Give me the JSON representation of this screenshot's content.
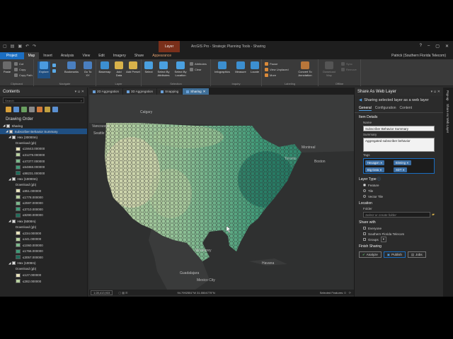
{
  "app": {
    "title": "ArcGIS Pro - Strategic Planning Tools - Sharing",
    "context_tab": "Layer",
    "user": "Patrick (Southern Florida Telecom)"
  },
  "ribbon_tabs": [
    "Project",
    "Map",
    "Insert",
    "Analysis",
    "View",
    "Edit",
    "Imagery",
    "Share",
    "Appearance"
  ],
  "ribbon": {
    "groups": [
      "Clipboard",
      "Navigate",
      "Layer",
      "Selection",
      "Inquiry",
      "Labeling",
      "Offline"
    ],
    "buttons": {
      "paste": "Paste",
      "cut": "Cut",
      "copy": "Copy",
      "copy_path": "Copy Path",
      "explore": "Explore",
      "bookmarks": "Bookmarks",
      "go_to_xy": "Go To XY",
      "basemap": "Basemap",
      "add_data": "Add Data",
      "add_preset": "Add Preset",
      "select": "Select",
      "select_by_attributes": "Select By Attributes",
      "select_by_location": "Select By Location",
      "attributes": "Attributes",
      "clear": "Clear",
      "infographics": "Infographics",
      "measure": "Measure",
      "locate": "Locate",
      "pause": "Pause",
      "view_unplaced": "View Unplaced",
      "more": "More",
      "convert_to_annotation": "Convert To Annotation",
      "download_map": "Download Map",
      "sync": "Sync",
      "remove": "Remove"
    }
  },
  "contents": {
    "title": "Contents",
    "search_placeholder": "Search",
    "drawing_order": "Drawing Order",
    "map_name": "Sharing",
    "group_layer": "Subscriber Behavior Summary",
    "layers": [
      {
        "name": "Hex (30000m)",
        "field": "Download (gb)",
        "classes": [
          "≤15643.000000",
          "≤31279.000000",
          "≤47377.000000",
          "≤64868.000000",
          "≤88231.000000"
        ],
        "colors": [
          "#e8e3bd",
          "#b8d1a0",
          "#7db98c",
          "#3f9c79",
          "#1e6e5c"
        ]
      },
      {
        "name": "Hex (10000m)",
        "field": "Download (gb)",
        "classes": [
          "≤851.000000",
          "≤1778.000000",
          "≤2597.000000",
          "≤3710.000000",
          "≤8290.000000"
        ],
        "colors": [
          "#e8e3bd",
          "#b8d1a0",
          "#7db98c",
          "#3f9c79",
          "#1e6e5c"
        ]
      },
      {
        "name": "Hex (5000m)",
        "field": "Download (gb)",
        "classes": [
          "≤234.000000",
          "≤441.000000",
          "≤1060.000000",
          "≤1766.000000",
          "≤3057.000000"
        ],
        "colors": [
          "#e8e3bd",
          "#b8d1a0",
          "#7db98c",
          "#3f9c79",
          "#1e6e5c"
        ]
      },
      {
        "name": "Hex (1000m)",
        "field": "Download (gb)",
        "classes": [
          "≤127.000000",
          "≤282.000000"
        ],
        "colors": [
          "#e8e3bd",
          "#b8d1a0"
        ]
      }
    ]
  },
  "view_tabs": [
    "2D Aggregation",
    "3D Aggregation",
    "Snapping",
    "Sharing"
  ],
  "map": {
    "scale": "1:28,413,933",
    "coordinates": "94.7992551°W 31.5504775°N",
    "selected_features": "Selected Features: 0",
    "places": [
      "Calgary",
      "Vancouver",
      "Seattle",
      "Toronto",
      "Montreal",
      "Boston",
      "Monterrey",
      "Havana",
      "Guadalajara",
      "Mexico City"
    ]
  },
  "share_pane": {
    "title": "Share As Web Layer",
    "subtitle": "Sharing selected layer as a web layer",
    "tabs": [
      "General",
      "Configuration",
      "Content"
    ],
    "item_details": "Item Details",
    "name_label": "Name",
    "name_value": "Subscriber Behavior Summary",
    "summary_label": "Summary",
    "summary_value": "Aggregated subscriber behavior",
    "tags_label": "Tags",
    "tags": [
      "Hexagon",
      "Binning",
      "Big Data",
      "SDT"
    ],
    "layer_type": "Layer Type",
    "layer_types": [
      "Feature",
      "Tile",
      "Vector Tile"
    ],
    "location": "Location",
    "folder_label": "Folder",
    "folder_placeholder": "Select or create folder",
    "share_with": "Share with",
    "share_options": [
      "Everyone",
      "Southern Florida Telecom",
      "Groups"
    ],
    "finish_sharing": "Finish Sharing",
    "buttons": [
      "Analyze",
      "Publish",
      "Jobs"
    ]
  },
  "side_tabs": [
    "Pop-up",
    "Share As Web Layer"
  ]
}
